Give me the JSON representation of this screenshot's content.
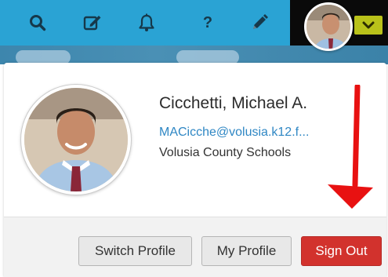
{
  "toolbar": {
    "icons": [
      "search-icon",
      "edit-icon",
      "bell-icon",
      "help-icon",
      "pencil-icon"
    ],
    "help_glyph": "?",
    "menu_caret": "chevron-down-icon",
    "colors": {
      "bar": "#2aa3d4",
      "dark": "#0a0a0a",
      "caret": "#b9c21a",
      "icon": "#16384a"
    }
  },
  "profile": {
    "name": "Cicchetti, Michael A.",
    "email": "MACicche@volusia.k12.f...",
    "organization": "Volusia County Schools",
    "avatar": "user-photo"
  },
  "actions": {
    "switch_profile": "Switch Profile",
    "my_profile": "My Profile",
    "sign_out": "Sign Out",
    "colors": {
      "sign_out_bg": "#d2322d",
      "default_bg": "#e8e8e8"
    }
  },
  "annotation": {
    "arrow_color": "#e81111",
    "points_to": "sign-out-button"
  }
}
